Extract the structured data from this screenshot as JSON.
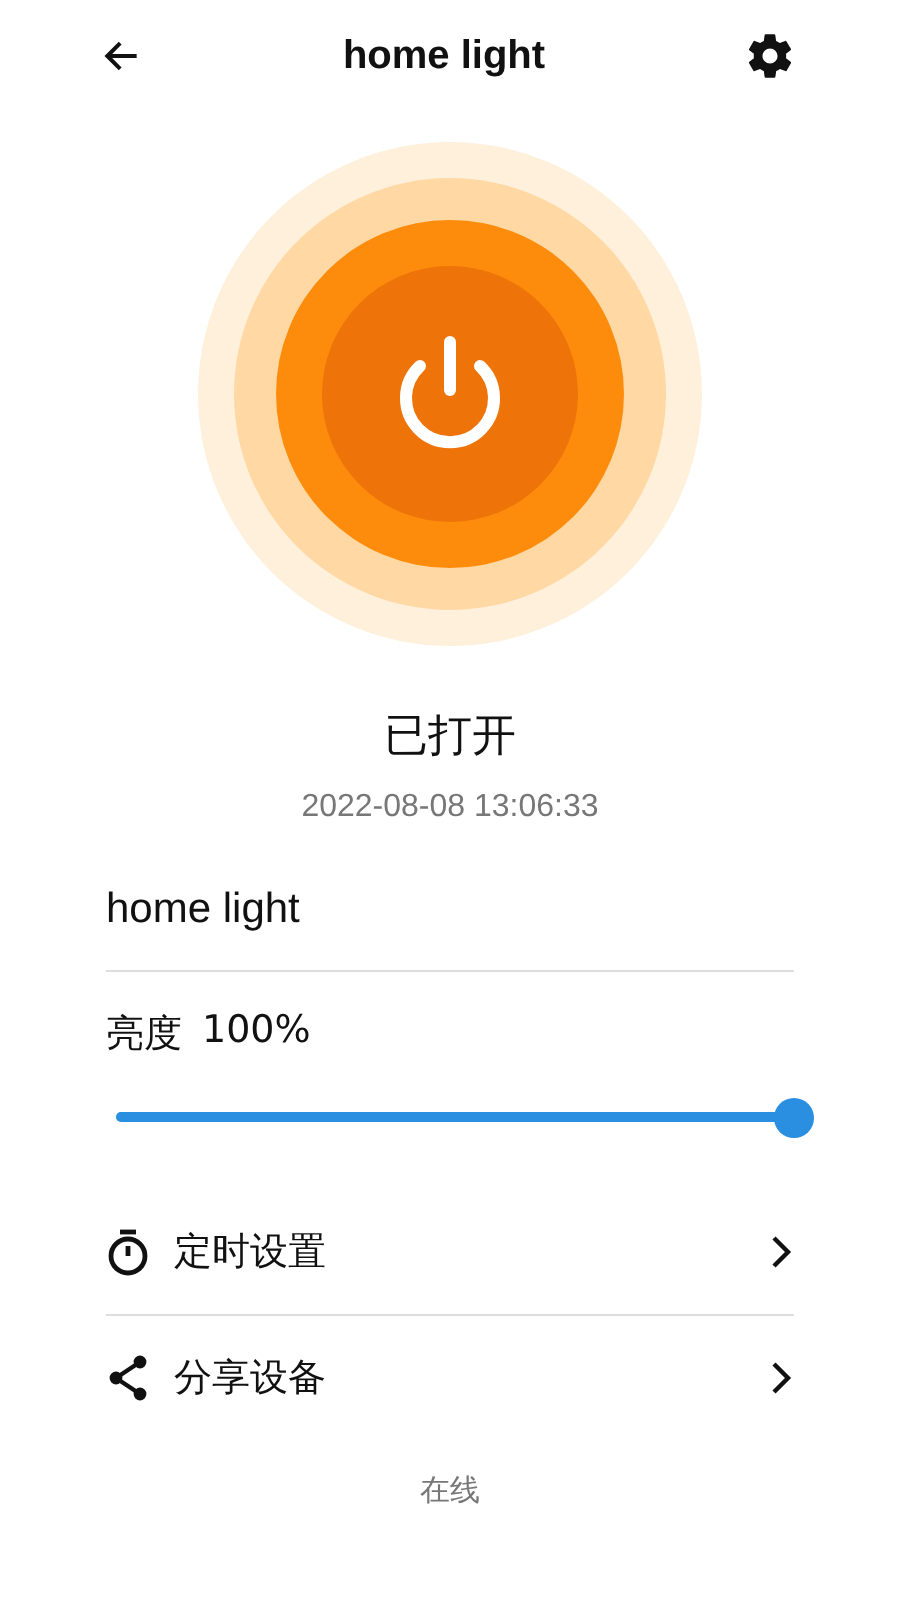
{
  "header": {
    "title": "home light"
  },
  "power": {
    "on": true
  },
  "status": {
    "text": "已打开",
    "time": "2022-08-08 13:06:33"
  },
  "device_name": "home light",
  "brightness": {
    "label": "亮度",
    "value": "100%",
    "level": 1
  },
  "menu": [
    {
      "kind": "timer",
      "label": "定时设置"
    },
    {
      "kind": "share",
      "label": "分享设备"
    }
  ],
  "footer": "在线"
}
